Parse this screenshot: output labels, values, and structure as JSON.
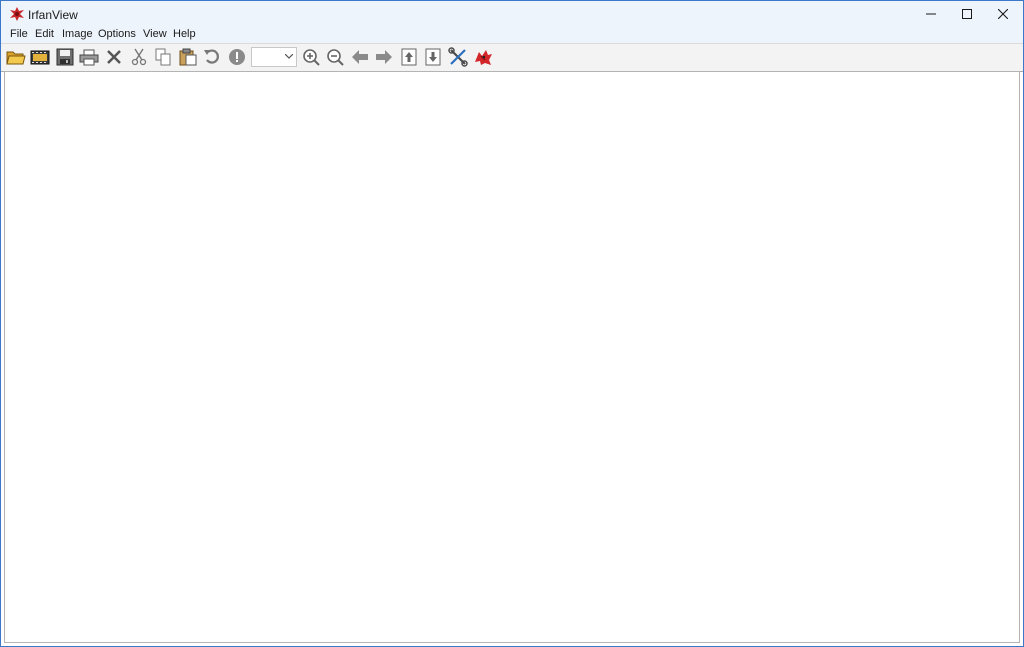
{
  "window": {
    "title": "IrfanView"
  },
  "menu": {
    "items": [
      "File",
      "Edit",
      "Image",
      "Options",
      "View",
      "Help"
    ]
  },
  "toolbar": {
    "zoom_value": "",
    "buttons": [
      "open-folder",
      "slideshow",
      "save",
      "print",
      "delete",
      "cut",
      "copy",
      "paste",
      "undo",
      "info",
      "zoom-in",
      "zoom-out",
      "previous",
      "next",
      "previous-page",
      "next-page",
      "settings",
      "about"
    ]
  },
  "colors": {
    "window_border": "#3b78c9",
    "titlebar_bg": "#eef4fb",
    "toolbar_bg": "#f3f3f3"
  }
}
